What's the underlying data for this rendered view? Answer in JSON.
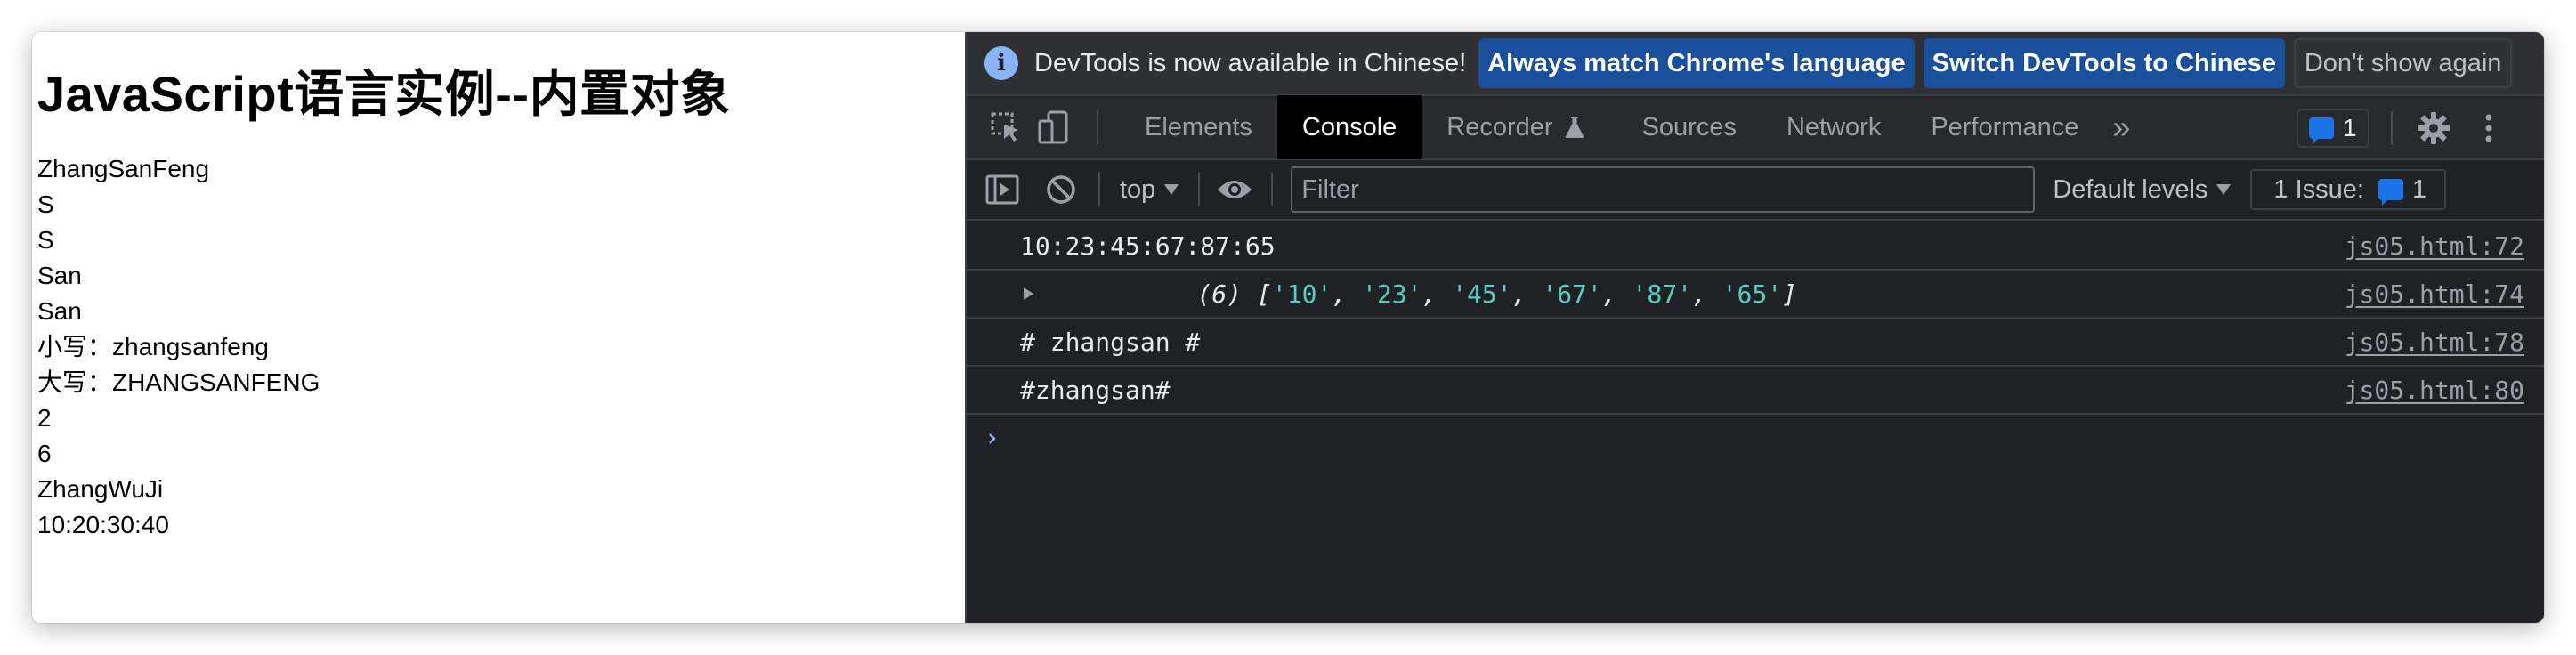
{
  "page": {
    "heading": "JavaScript语言实例--内置对象",
    "lines": [
      "ZhangSanFeng",
      "S",
      "S",
      "San",
      "San",
      "小写：zhangsanfeng",
      "大写：ZHANGSANFENG",
      "2",
      "6",
      "ZhangWuJi",
      "10:20:30:40"
    ]
  },
  "devtools": {
    "infobar": {
      "text": "DevTools is now available in Chinese!",
      "btn_match": "Always match Chrome's language",
      "btn_switch": "Switch DevTools to Chinese",
      "btn_dismiss": "Don't show again"
    },
    "tabs": {
      "elements": "Elements",
      "console": "Console",
      "recorder": "Recorder",
      "sources": "Sources",
      "network": "Network",
      "performance": "Performance",
      "more": "»"
    },
    "issues_badge_count": "1",
    "filterbar": {
      "context": "top",
      "filter_placeholder": "Filter",
      "levels": "Default levels",
      "issues_label": "1 Issue:",
      "issues_count": "1"
    },
    "console": {
      "row1": {
        "text": "10:23:45:67:87:65",
        "source": "js05.html:72"
      },
      "row2": {
        "prefix": "(6) [",
        "items": [
          "'10'",
          "'23'",
          "'45'",
          "'67'",
          "'87'",
          "'65'"
        ],
        "suffix": "]",
        "source": "js05.html:74"
      },
      "row3": {
        "text": "# zhangsan #",
        "source": "js05.html:78"
      },
      "row4": {
        "text": "#zhangsan#",
        "source": "js05.html:80"
      },
      "prompt": "›"
    }
  },
  "colors": {
    "devtools_bg": "#202124",
    "accent_button": "#1a4f9c",
    "string_value": "#4fd1c5",
    "prompt": "#8ab4f8"
  }
}
